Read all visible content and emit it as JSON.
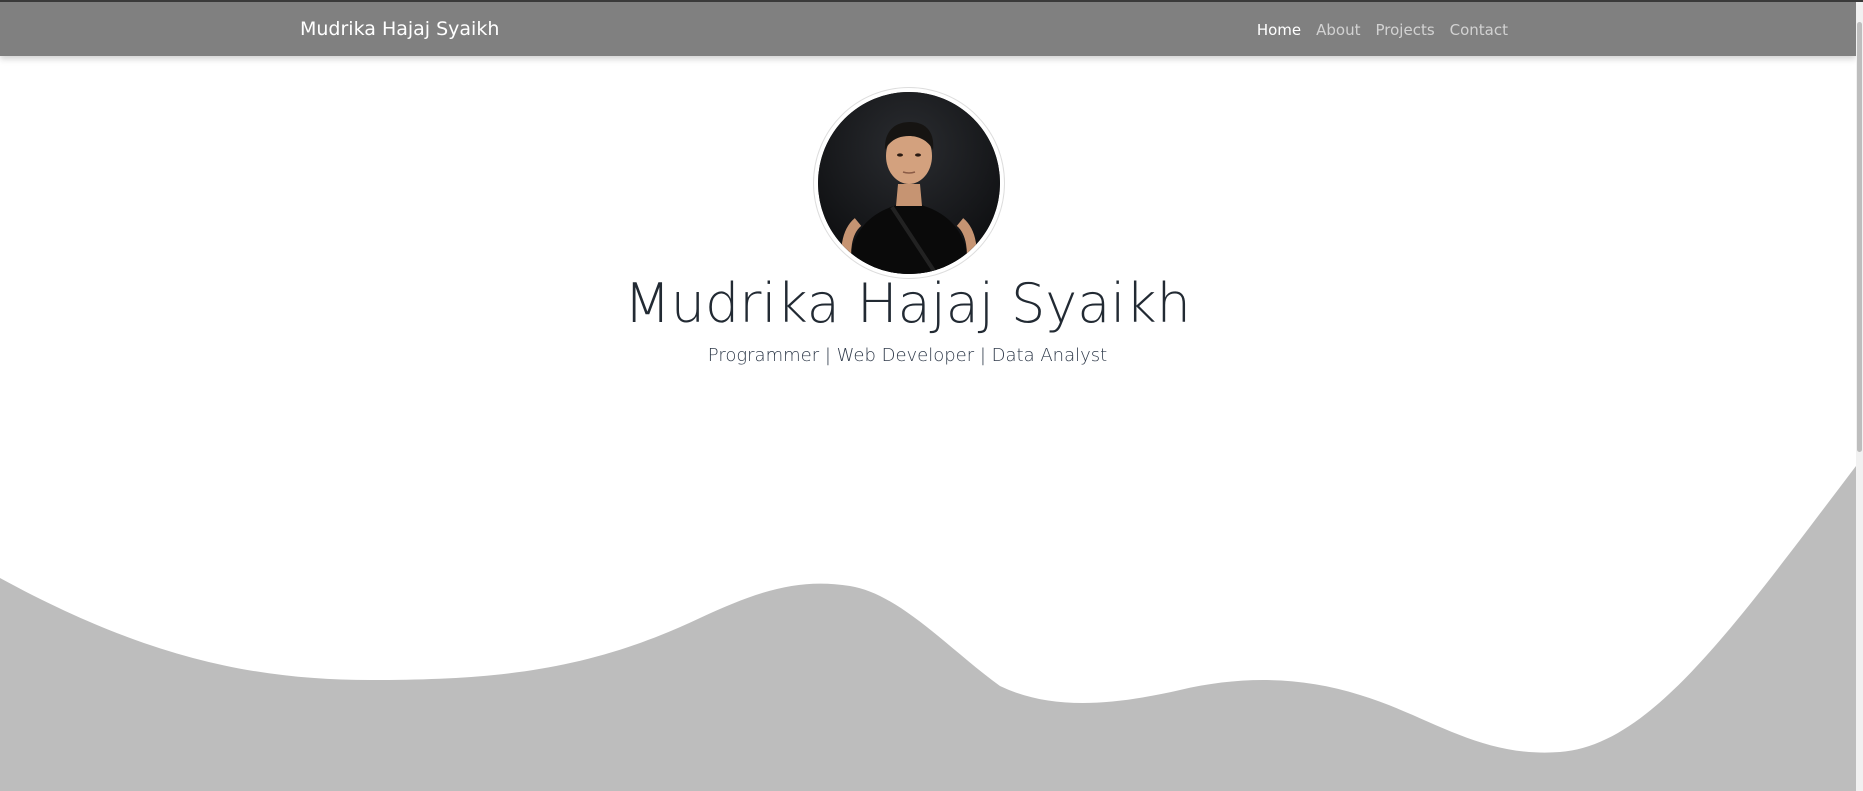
{
  "navbar": {
    "brand": "Mudrika Hajaj Syaikh",
    "links": [
      {
        "label": "Home",
        "active": true
      },
      {
        "label": "About",
        "active": false
      },
      {
        "label": "Projects",
        "active": false
      },
      {
        "label": "Contact",
        "active": false
      }
    ]
  },
  "hero": {
    "name": "Mudrika Hajaj Syaikh",
    "tagline": "Programmer | Web Developer | Data Analyst"
  },
  "colors": {
    "navbar_bg": "#808080",
    "wave_fill": "#bdbdbd",
    "text_dark": "#222a33"
  },
  "icons": {
    "avatar": "profile-photo"
  }
}
